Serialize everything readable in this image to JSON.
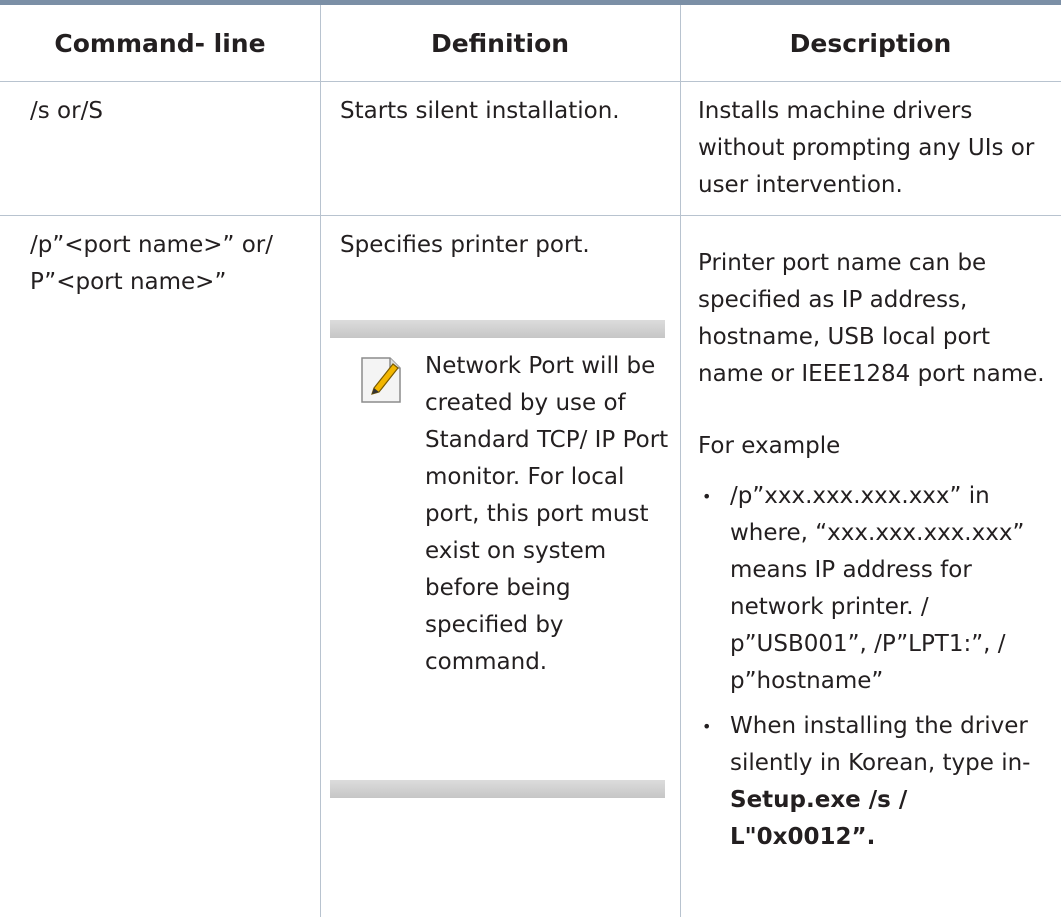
{
  "table": {
    "headers": [
      "Command- line",
      "Definition",
      "Description"
    ],
    "rows": [
      {
        "command": "/s or/S",
        "definition": "Starts silent installation.",
        "description": "Installs machine drivers without prompting any UIs or user intervention."
      },
      {
        "command": "/p”<port name>” or/ P”<port name>”",
        "definition": "Specifies printer port.",
        "note": {
          "icon": "note-pencil-icon",
          "text": "Network Port will be created by use of Standard TCP/ IP Port monitor. For local port, this port must exist on system before being specified by command."
        },
        "description": "Printer port name can be specified as IP address, hostname, USB local port name or IEEE1284 port name.",
        "example_label": "For example",
        "bullets": [
          "/p”xxx.xxx.xxx.xxx” in where, “xxx.xxx.xxx.xxx” means IP address for network printer. / p”USB001”, /P”LPT1:”, / p”hostname”",
          "When installing the driver silently in Korean, type in-"
        ],
        "bullet_bold": "Setup.exe /s / L\"0x0012”."
      }
    ]
  }
}
